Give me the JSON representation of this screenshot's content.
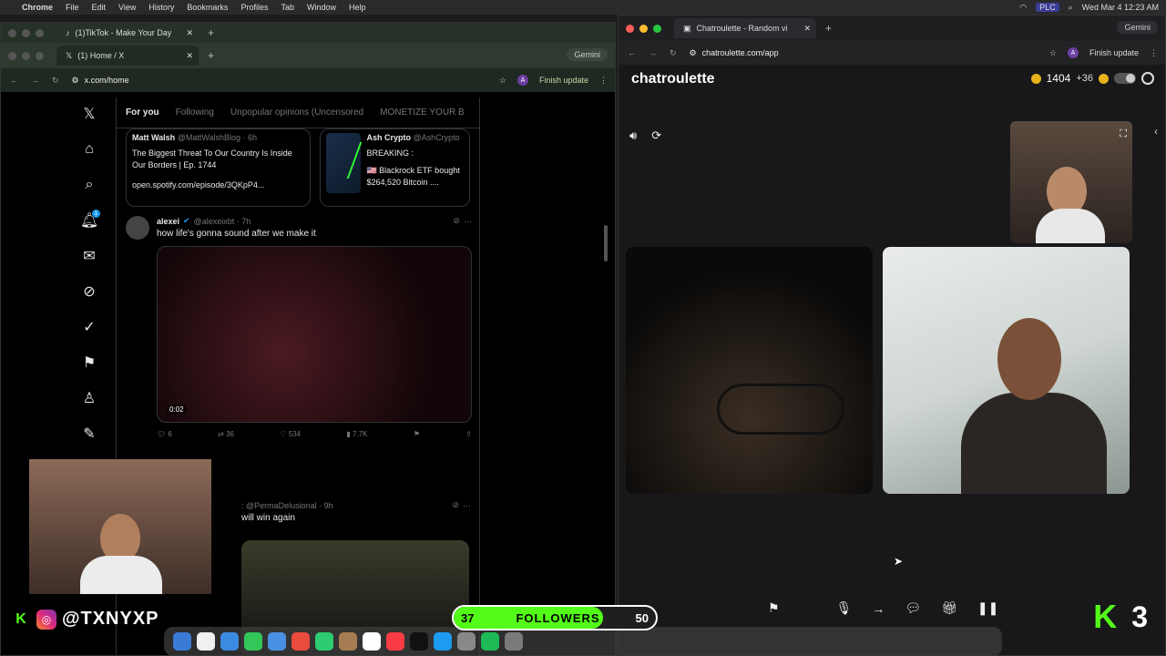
{
  "menubar": {
    "app": "Chrome",
    "items": [
      "File",
      "Edit",
      "View",
      "History",
      "Bookmarks",
      "Profiles",
      "Tab",
      "Window",
      "Help"
    ],
    "status": "PLC",
    "datetime": "Wed Mar 4  12:23 AM"
  },
  "left_window": {
    "back_tab": {
      "title": "(1)TikTok - Make Your Day"
    },
    "tab": {
      "title": "(1) Home / X"
    },
    "gemini": "Gemini",
    "url": "x.com/home",
    "avatar": "A",
    "finish_update": "Finish update",
    "x": {
      "tabs": [
        "For you",
        "Following",
        "Unpopular opinions (Uncensored",
        "MONETIZE YOUR B"
      ],
      "notification_count": "1",
      "card1": {
        "author": "Matt Walsh",
        "handle": "@MattWalshBlog · 6h",
        "title": "The Biggest Threat To Our Country Is Inside Our Borders | Ep. 1744",
        "link": "open.spotify.com/episode/3QKpP4..."
      },
      "card2": {
        "author": "Ash Crypto",
        "handle": "@AshCrypto",
        "title": "BREAKING :",
        "text": "🇺🇸 Blackrock ETF bought  $264,520 Bitcoin ...."
      },
      "tweet1": {
        "author": "alexei",
        "handle": "@alexeixbt · 7h",
        "text": "how life's gonna sound after we make it",
        "duration": "0:02",
        "replies": "6",
        "reposts": "36",
        "likes": "534",
        "views": "7.7K"
      },
      "tweet2": {
        "handle": ": @PermaDelusional · 9h",
        "text": "will win again"
      }
    }
  },
  "right_window": {
    "tab": {
      "title": "Chatroulette - Random vi"
    },
    "gemini": "Gemini",
    "url": "chatroulette.com/app",
    "avatar": "A",
    "finish_update": "Finish update",
    "app": {
      "logo": "chatroulette",
      "coins": "1404",
      "bonus": "+36"
    }
  },
  "overlay": {
    "handle": "@TXNYXP",
    "followers": {
      "current": "37",
      "label": "FOLLOWERS",
      "goal": "50",
      "progress": 0.74
    },
    "kick_count": "3"
  },
  "colors": {
    "kick_green": "#53fc18",
    "x_blue": "#1d9bf0",
    "coin_gold": "#e8b21c"
  }
}
